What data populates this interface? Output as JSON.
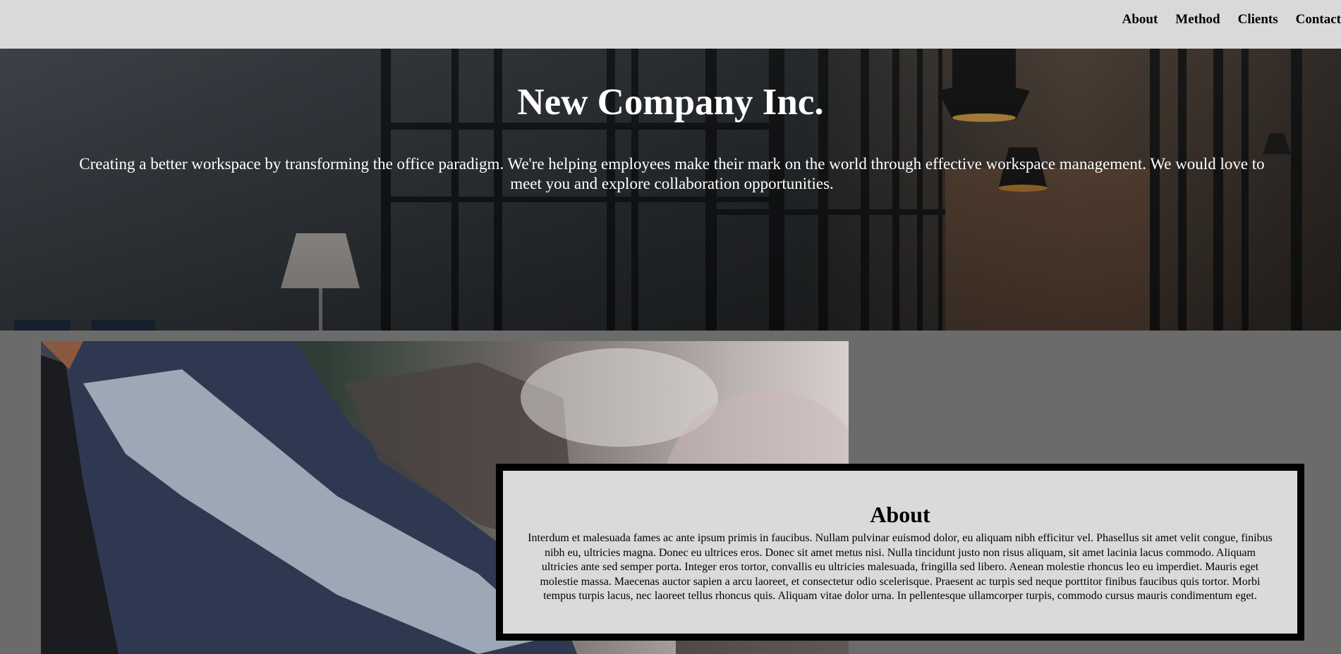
{
  "nav": {
    "items": [
      "About",
      "Method",
      "Clients",
      "Contact"
    ]
  },
  "hero": {
    "title": "New Company Inc.",
    "text": "Creating a better workspace by transforming the office paradigm. We're helping employees make their mark on the world through effective workspace management. We would love to meet you and explore collaboration opportunities."
  },
  "about": {
    "title": "About",
    "text": "Interdum et malesuada fames ac ante ipsum primis in faucibus. Nullam pulvinar euismod dolor, eu aliquam nibh efficitur vel. Phasellus sit amet velit congue, finibus nibh eu, ultricies magna. Donec eu ultrices eros. Donec sit amet metus nisi. Nulla tincidunt justo non risus aliquam, sit amet lacinia lacus commodo. Aliquam ultricies ante sed semper porta. Integer eros tortor, convallis eu ultricies malesuada, fringilla sed libero. Aenean molestie rhoncus leo eu imperdiet. Mauris eget molestie massa. Maecenas auctor sapien a arcu laoreet, et consectetur odio scelerisque. Praesent ac turpis sed neque porttitor finibus faucibus quis tortor. Morbi tempus turpis lacus, nec laoreet tellus rhoncus quis. Aliquam vitae dolor urna. In pellentesque ullamcorper turpis, commodo cursus mauris condimentum eget."
  },
  "colors": {
    "navbar_bg": "#d9d9d9",
    "page_bg": "#6b6b6b",
    "hero_text": "#ffffff",
    "card_border": "#000000",
    "card_bg": "#ebebeb"
  }
}
